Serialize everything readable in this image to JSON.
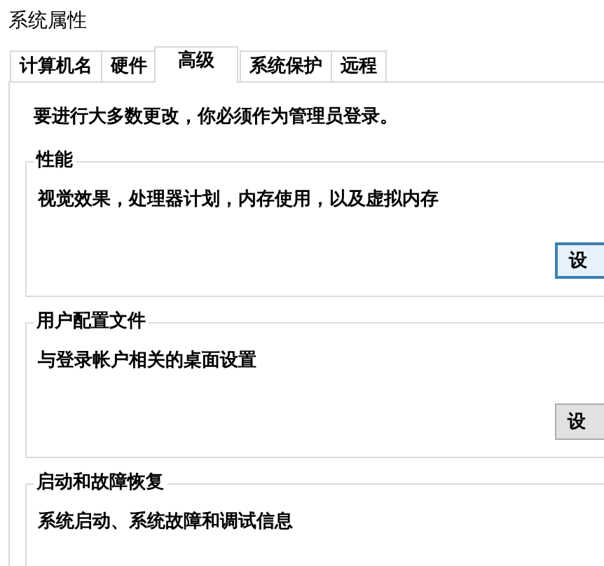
{
  "window": {
    "title": "系统属性"
  },
  "tabs": [
    {
      "label": "计算机名",
      "selected": false
    },
    {
      "label": "硬件",
      "selected": false
    },
    {
      "label": "高级",
      "selected": true
    },
    {
      "label": "系统保护",
      "selected": false
    },
    {
      "label": "远程",
      "selected": false
    }
  ],
  "notice": "要进行大多数更改，你必须作为管理员登录。",
  "groups": [
    {
      "title": "性能",
      "description": "视觉效果，处理器计划，内存使用，以及虚拟内存",
      "button": {
        "label": "设",
        "default": true
      }
    },
    {
      "title": "用户配置文件",
      "description": "与登录帐户相关的桌面设置",
      "button": {
        "label": "设",
        "default": false
      }
    },
    {
      "title": "启动和故障恢复",
      "description": "系统启动、系统故障和调试信息"
    }
  ]
}
